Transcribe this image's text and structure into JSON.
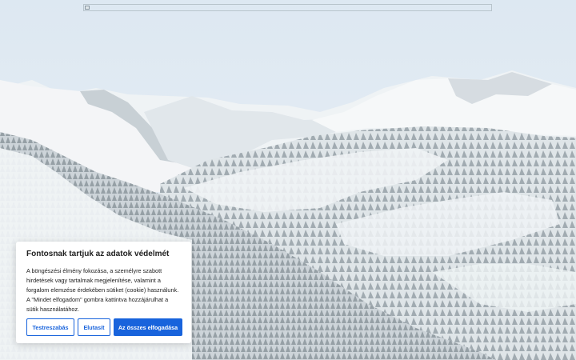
{
  "consent": {
    "title": "Fontosnak tartjuk az adatok védelmét",
    "body": "A böngészési élmény fokozása, a személyre szabott hirdetések vagy tartalmak megjelenítése, valamint a forgalom elemzése érdekében sütiket (cookie) használunk. A \"Mindet elfogadom\" gombra kattintva hozzájárulhat a sütik használatához.",
    "customize_label": "Testreszabás",
    "reject_label": "Elutasít",
    "accept_all_label": "Az összes elfogadása",
    "accent_color": "#1863dc"
  },
  "background": {
    "icon": "snowy-mountain-landscape"
  },
  "header": {
    "logo_icon": "broken-image-icon"
  }
}
